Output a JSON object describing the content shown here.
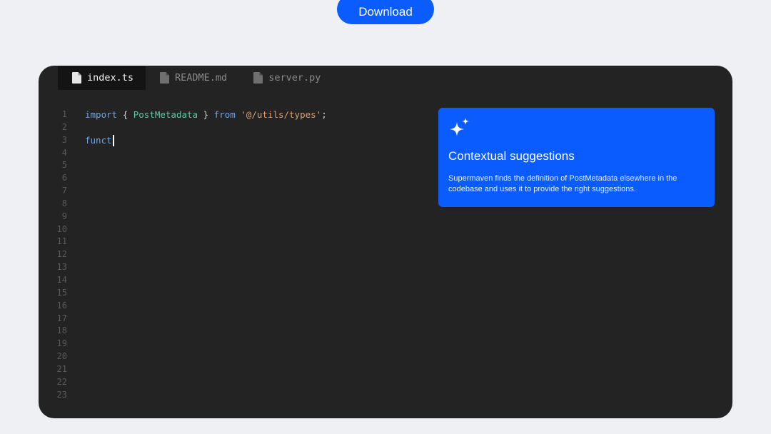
{
  "header": {
    "download_label": "Download"
  },
  "editor": {
    "tabs": [
      {
        "label": "index.ts",
        "active": true
      },
      {
        "label": "README.md",
        "active": false
      },
      {
        "label": "server.py",
        "active": false
      }
    ],
    "line_numbers": [
      "1",
      "2",
      "3",
      "4",
      "5",
      "6",
      "7",
      "8",
      "9",
      "10",
      "11",
      "12",
      "13",
      "14",
      "15",
      "16",
      "17",
      "18",
      "19",
      "20",
      "21",
      "22",
      "23"
    ],
    "code": {
      "line1": {
        "kw_import": "import",
        "brace_open": "{",
        "ident": "PostMetadata",
        "brace_close": "}",
        "kw_from": "from",
        "string": "'@/utils/types'",
        "semicolon": ";"
      },
      "line3": {
        "typed": "funct"
      }
    }
  },
  "card": {
    "icon": "sparkle-icon",
    "title": "Contextual suggestions",
    "description": "Supermaven finds the definition of PostMetadata elsewhere in the codebase and uses it to provide the right suggestions."
  },
  "colors": {
    "page_background": "#eff0f3",
    "accent_blue": "#0a5cff",
    "editor_background": "#232323",
    "active_tab_background": "#141414",
    "keyword": "#6fa4e8",
    "identifier": "#5fc7a6",
    "string": "#d9a06b"
  }
}
